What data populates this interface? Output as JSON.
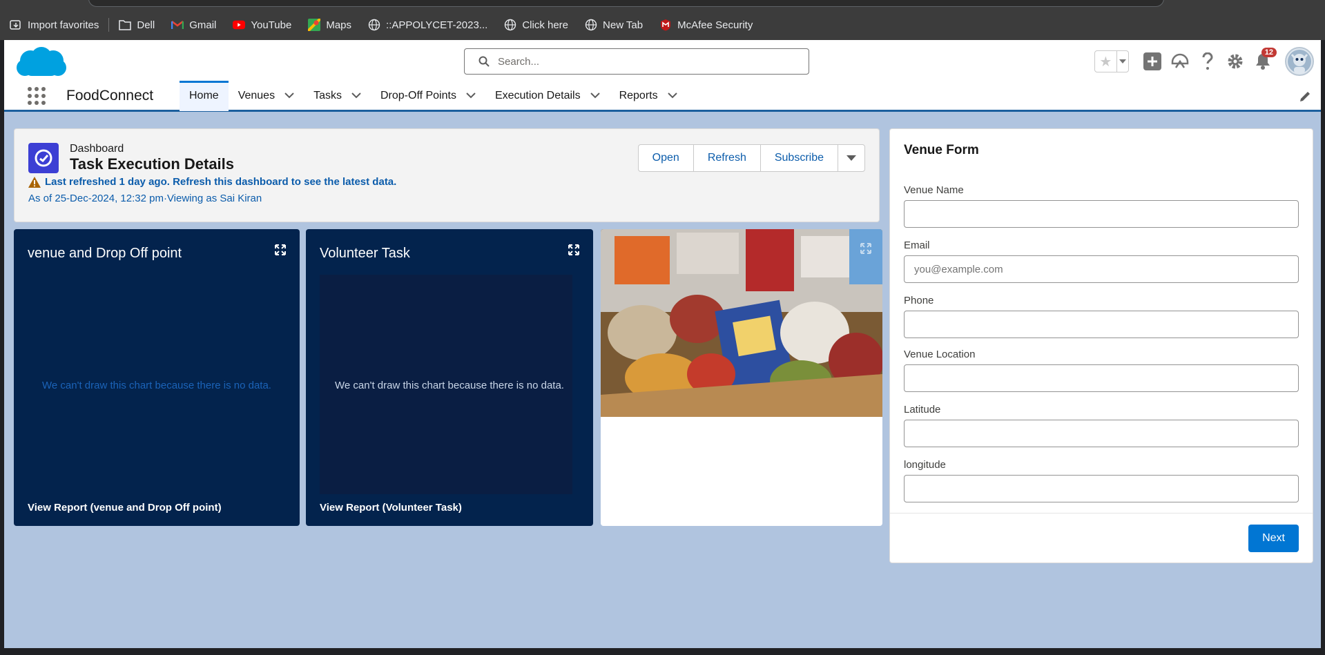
{
  "bookmarks": [
    {
      "label": "Import favorites",
      "icon": "import-icon"
    },
    {
      "label": "Dell",
      "icon": "folder-icon"
    },
    {
      "label": "Gmail",
      "icon": "gmail-icon"
    },
    {
      "label": "YouTube",
      "icon": "youtube-icon"
    },
    {
      "label": "Maps",
      "icon": "maps-icon"
    },
    {
      "label": "::APPOLYCET-2023...",
      "icon": "globe-icon"
    },
    {
      "label": "Click here",
      "icon": "globe-icon"
    },
    {
      "label": "New Tab",
      "icon": "globe-icon"
    },
    {
      "label": "McAfee Security",
      "icon": "mcafee-icon"
    }
  ],
  "header": {
    "search_placeholder": "Search...",
    "notification_count": "12"
  },
  "nav": {
    "app_name": "FoodConnect",
    "tabs": [
      {
        "label": "Home",
        "active": true,
        "dropdown": false
      },
      {
        "label": "Venues",
        "dropdown": true
      },
      {
        "label": "Tasks",
        "dropdown": true
      },
      {
        "label": "Drop-Off Points",
        "dropdown": true
      },
      {
        "label": "Execution Details",
        "dropdown": true
      },
      {
        "label": "Reports",
        "dropdown": true
      }
    ]
  },
  "dashboard": {
    "type_label": "Dashboard",
    "title": "Task Execution Details",
    "warning": "Last refreshed 1 day ago. Refresh this dashboard to see the latest data.",
    "as_of": "As of 25-Dec-2024, 12:32 pm·Viewing as Sai Kiran",
    "buttons": {
      "open": "Open",
      "refresh": "Refresh",
      "subscribe": "Subscribe"
    }
  },
  "cards": [
    {
      "title": "venue and Drop Off point",
      "nodata": "We can't draw this chart because there is no data.",
      "footer": "View Report (venue and Drop Off point)"
    },
    {
      "title": "Volunteer Task",
      "nodata": "We can't draw this chart because there is no data.",
      "footer": "View Report (Volunteer Task)"
    }
  ],
  "form": {
    "title": "Venue Form",
    "fields": [
      {
        "label": "Venue Name",
        "value": "",
        "placeholder": ""
      },
      {
        "label": "Email",
        "value": "",
        "placeholder": "you@example.com"
      },
      {
        "label": "Phone",
        "value": "",
        "placeholder": ""
      },
      {
        "label": "Venue Location",
        "value": "",
        "placeholder": ""
      },
      {
        "label": "Latitude",
        "value": "",
        "placeholder": ""
      },
      {
        "label": "longitude",
        "value": "",
        "placeholder": ""
      }
    ],
    "next_label": "Next"
  },
  "colors": {
    "accent": "#0176d3",
    "card_dark": "#03234d",
    "page_bg": "#b0c4df",
    "nodata_card1": "#1b63b8",
    "nodata_card2": "#c9d6e8"
  }
}
